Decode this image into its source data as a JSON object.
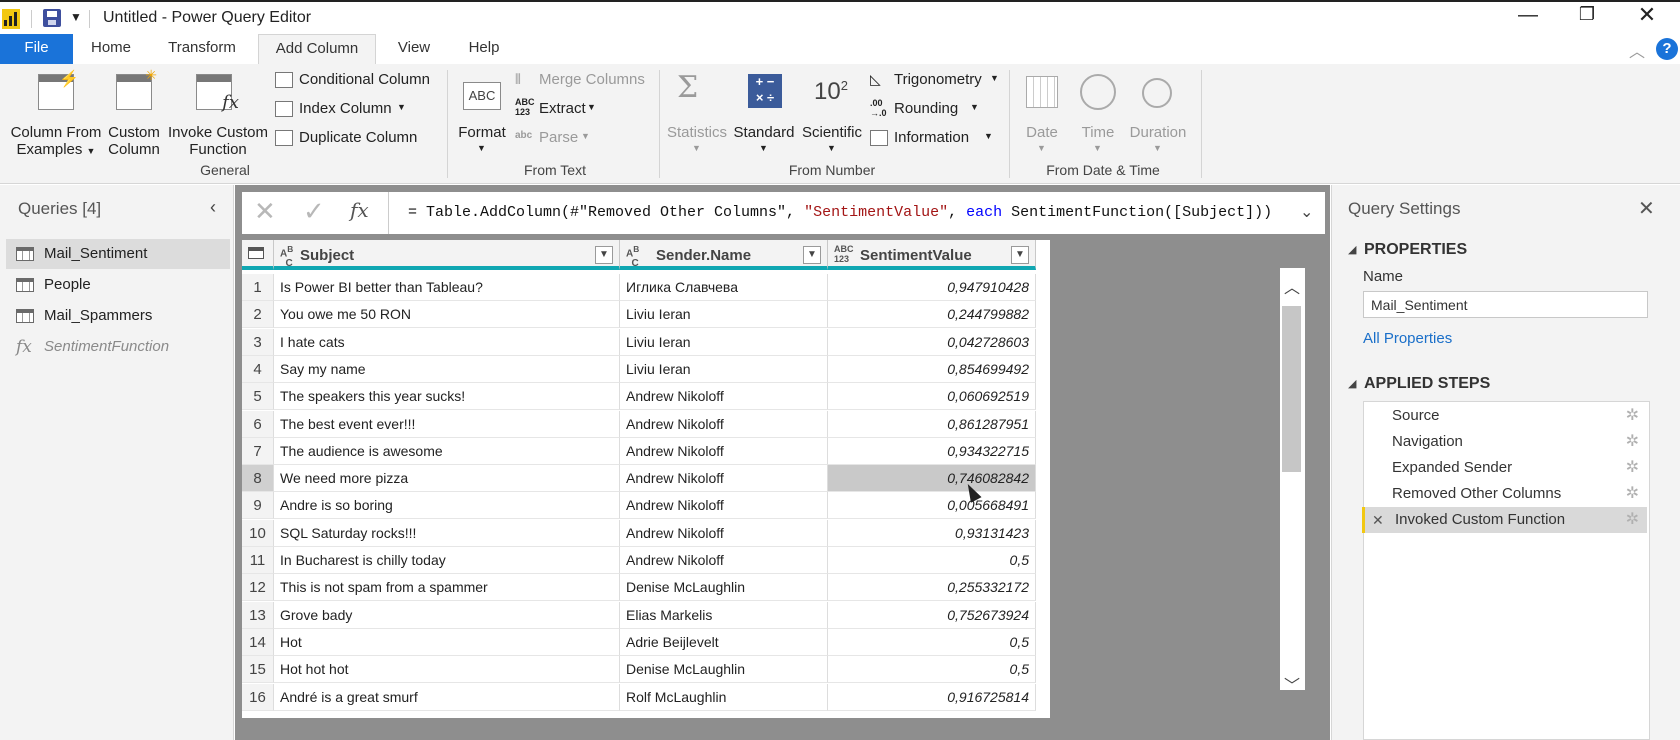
{
  "window": {
    "title": "Untitled - Power Query Editor"
  },
  "tabs": [
    "File",
    "Home",
    "Transform",
    "Add Column",
    "View",
    "Help"
  ],
  "ribbon": {
    "general": {
      "label": "General",
      "column_from_examples": [
        "Column From",
        "Examples"
      ],
      "custom_column": [
        "Custom",
        "Column"
      ],
      "invoke_custom_function": [
        "Invoke Custom",
        "Function"
      ],
      "conditional_column": "Conditional Column",
      "index_column": "Index Column",
      "duplicate_column": "Duplicate Column"
    },
    "from_text": {
      "label": "From Text",
      "format": "Format",
      "merge_columns": "Merge Columns",
      "extract": "Extract",
      "parse": "Parse"
    },
    "from_number": {
      "label": "From Number",
      "statistics": "Statistics",
      "standard": "Standard",
      "scientific": "Scientific",
      "trigonometry": "Trigonometry",
      "rounding": "Rounding",
      "information": "Information"
    },
    "from_date_time": {
      "label": "From Date & Time",
      "date": "Date",
      "time": "Time",
      "duration": "Duration"
    }
  },
  "queries": {
    "title": "Queries [4]",
    "items": [
      {
        "label": "Mail_Sentiment",
        "kind": "table"
      },
      {
        "label": "People",
        "kind": "table"
      },
      {
        "label": "Mail_Spammers",
        "kind": "table"
      },
      {
        "label": "SentimentFunction",
        "kind": "function"
      }
    ]
  },
  "formula": {
    "prefix": "= Table.AddColumn(#\"Removed Other Columns\", ",
    "string": "\"SentimentValue\"",
    "mid": ", ",
    "keyword": "each",
    "suffix": " SentimentFunction([Subject]))"
  },
  "grid": {
    "columns": [
      {
        "type": "ABC",
        "label": "Subject"
      },
      {
        "type": "ABC",
        "label": "Sender.Name"
      },
      {
        "type": "ABC 123",
        "label": "SentimentValue"
      }
    ],
    "rows": [
      {
        "n": "1",
        "subject": "Is Power BI better than Tableau?",
        "sender": "Иглика Славчева",
        "value": "0,947910428"
      },
      {
        "n": "2",
        "subject": "You owe me 50 RON",
        "sender": "Liviu Ieran",
        "value": "0,244799882"
      },
      {
        "n": "3",
        "subject": "I hate cats",
        "sender": "Liviu Ieran",
        "value": "0,042728603"
      },
      {
        "n": "4",
        "subject": "Say my name",
        "sender": "Liviu Ieran",
        "value": "0,854699492"
      },
      {
        "n": "5",
        "subject": "The speakers this year sucks!",
        "sender": "Andrew Nikoloff",
        "value": "0,060692519"
      },
      {
        "n": "6",
        "subject": "The best event ever!!!",
        "sender": "Andrew Nikoloff",
        "value": "0,861287951"
      },
      {
        "n": "7",
        "subject": "The audience is awesome",
        "sender": "Andrew Nikoloff",
        "value": "0,934322715"
      },
      {
        "n": "8",
        "subject": "We need more pizza",
        "sender": "Andrew Nikoloff",
        "value": "0,746082842"
      },
      {
        "n": "9",
        "subject": "Andre is so boring",
        "sender": "Andrew Nikoloff",
        "value": "0,005668491"
      },
      {
        "n": "10",
        "subject": "SQL Saturday rocks!!!",
        "sender": "Andrew Nikoloff",
        "value": "0,93131423"
      },
      {
        "n": "11",
        "subject": "In Bucharest is chilly today",
        "sender": "Andrew Nikoloff",
        "value": "0,5"
      },
      {
        "n": "12",
        "subject": "This is not spam from a spammer",
        "sender": "Denise McLaughlin",
        "value": "0,255332172"
      },
      {
        "n": "13",
        "subject": "Grove bady",
        "sender": "Elias Markelis",
        "value": "0,752673924"
      },
      {
        "n": "14",
        "subject": "Hot",
        "sender": "Adrie Beijlevelt",
        "value": "0,5"
      },
      {
        "n": "15",
        "subject": "Hot hot hot",
        "sender": "Denise McLaughlin",
        "value": "0,5"
      },
      {
        "n": "16",
        "subject": "André is a great smurf",
        "sender": "Rolf McLaughlin",
        "value": "0,916725814"
      }
    ]
  },
  "settings": {
    "title": "Query Settings",
    "properties_label": "PROPERTIES",
    "name_label": "Name",
    "name_value": "Mail_Sentiment",
    "all_properties": "All Properties",
    "applied_steps_label": "APPLIED STEPS",
    "steps": [
      "Source",
      "Navigation",
      "Expanded Sender",
      "Removed Other Columns",
      "Invoked Custom Function"
    ]
  },
  "colors": {
    "file_tab": "#1a73d9",
    "header_underline": "#10a7b2",
    "link": "#1a6fc9",
    "string": "#a31515",
    "keyword": "#0000ff"
  }
}
